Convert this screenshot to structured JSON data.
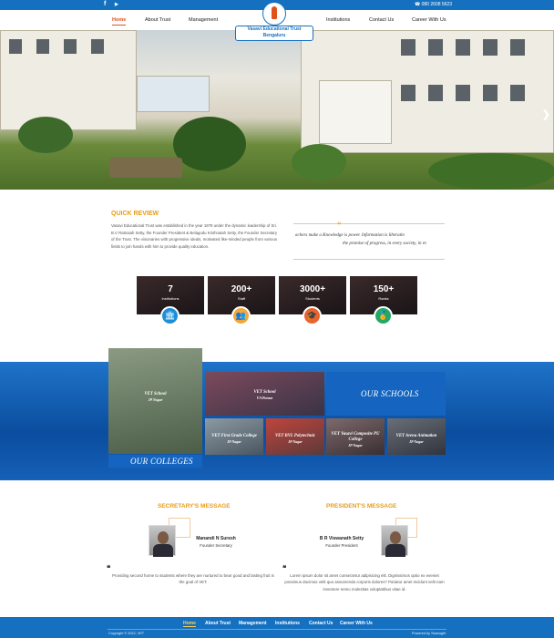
{
  "topbar": {
    "social": [
      "f",
      "▶"
    ],
    "phone": "080 2608 5623"
  },
  "nav": {
    "left": [
      "Home",
      "About Trust",
      "Management"
    ],
    "right": [
      "Institutions",
      "Contact Us",
      "Career With Us"
    ]
  },
  "logo": {
    "line1": "Vasavi Educational Trust",
    "line2": "Bengaluru"
  },
  "quick_review": {
    "title": "QUICK REVIEW",
    "text": "Vasavi Educational Trust was established in the year 1978 under the dynamic leadership of Sri. B.V Ratnaiah Setty, the Founder President & Belagodu Krishnaiah Setty, the Founder Secretary of the Trust. The visionaries with progressive ideals, motivated like-minded people from various fields to join hands with him to provide quality education."
  },
  "quote": {
    "mark": "“",
    "line1": "achers make a     Knowledge is power. Information is liberatin",
    "line2": "the promise of progress, in every society, in ev"
  },
  "stats": [
    {
      "number": "7",
      "label": "Institutions",
      "icon": "🏛",
      "color": "#1d8fd8"
    },
    {
      "number": "200+",
      "label": "Staff",
      "icon": "👥",
      "color": "#f2a73b"
    },
    {
      "number": "3000+",
      "label": "Students",
      "icon": "🎓",
      "color": "#e8632d"
    },
    {
      "number": "150+",
      "label": "Ranks",
      "icon": "🏅",
      "color": "#24a865"
    }
  ],
  "schools": {
    "colleges_caption": "OUR COLLEGES",
    "schools_caption": "OUR SCHOOLS",
    "tiles": [
      {
        "name": "VET School",
        "place": "JP Nagar"
      },
      {
        "name": "VET School",
        "place": "V.V.Puram"
      },
      {
        "name": "VET First Grade College",
        "place": "JP Nagar"
      },
      {
        "name": "VET BVL Polytechnic",
        "place": "JP Nagar"
      },
      {
        "name": "VET Vasavi Composite PU College",
        "place": "JP Nagar"
      },
      {
        "name": "VET Arena Animation",
        "place": "JP Nagar"
      }
    ]
  },
  "secretary": {
    "title": "SECRETARY'S MESSAGE",
    "name": "Manandi N Suresh",
    "role": "Founder Secretary",
    "quote_mark": "❝",
    "message": "Providing second home to students where they are nurtured to bear good and lasting fruit is the goal of VET."
  },
  "president": {
    "title": "PRESIDENT'S MESSAGE",
    "name": "B R Viswanath Setty",
    "role": "Founder President",
    "quote_mark": "❝",
    "message": "Lorem ipsum dolor sit amet consectetur adipisicing elit. Dignissimos optio ex eveniet possimus ducimus velit quo assumenda corporis dolores? Pariatur amet incidunt velit nam inventore nemo molestias voluptatibus vitae id."
  },
  "footer": {
    "links": [
      "Home",
      "About Trust",
      "Management",
      "Institutions",
      "Contact Us",
      "Career With Us"
    ],
    "copyright": "Copyright © 2022, VET",
    "powered": "Powered by Swaraght"
  }
}
